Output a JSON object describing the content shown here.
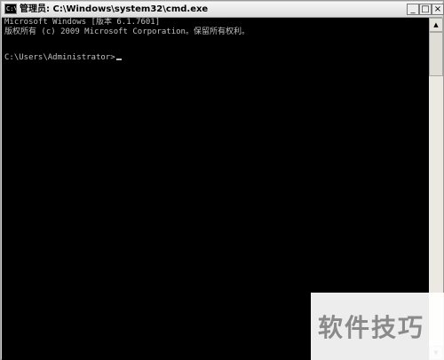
{
  "window": {
    "title": "管理员: C:\\Windows\\system32\\cmd.exe",
    "icon_label": "C:\\",
    "controls": {
      "minimize": "_",
      "maximize": "□",
      "close": "×"
    }
  },
  "console": {
    "lines": [
      "Microsoft Windows [版本 6.1.7601]",
      "版权所有 (c) 2009 Microsoft Corporation。保留所有权利。"
    ],
    "prompt": "C:\\Users\\Administrator>"
  },
  "scrollbar": {
    "up_arrow": "▲",
    "down_arrow": "▼"
  },
  "watermark": {
    "text": "软件技巧"
  }
}
